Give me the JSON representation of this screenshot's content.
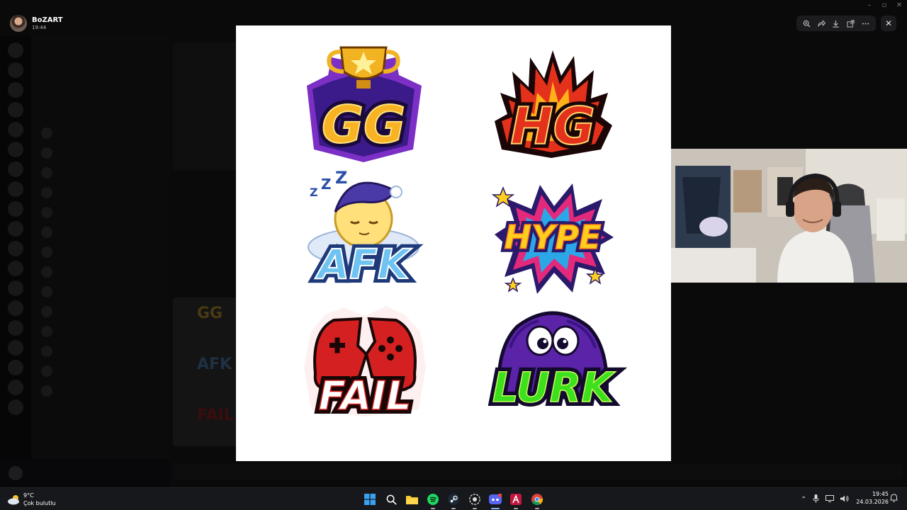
{
  "viewer": {
    "sender_name": "BoZART",
    "sender_time": "19:44",
    "toolbar_icons": [
      "zoom-in-icon",
      "forward-icon",
      "download-icon",
      "open-external-icon",
      "more-icon"
    ],
    "close_icon": "close-icon"
  },
  "stickers": [
    {
      "text": "GG",
      "colors": [
        "#f7b324",
        "#7b2fc4",
        "#1a0a3a"
      ]
    },
    {
      "text": "HG",
      "colors": [
        "#e4311b",
        "#ffb11b",
        "#1a0606"
      ]
    },
    {
      "text": "AFK",
      "colors": [
        "#6fc3f2",
        "#2c6fd6",
        "#ffe07a"
      ]
    },
    {
      "text": "HYPE",
      "colors": [
        "#ffcf1f",
        "#e3297c",
        "#2b1a6b"
      ]
    },
    {
      "text": "FAIL",
      "colors": [
        "#d42020",
        "#ffffff",
        "#1a0606"
      ]
    },
    {
      "text": "LURK",
      "colors": [
        "#3ce01c",
        "#5a23a8",
        "#130a2e"
      ]
    }
  ],
  "taskbar": {
    "weather_temp": "9°C",
    "weather_condition": "Çok bulutlu",
    "time": "19:45",
    "date": "24.03.2026",
    "apps": [
      "start",
      "search",
      "file-explorer",
      "spotify",
      "steam",
      "github",
      "discord",
      "affinity",
      "chrome"
    ]
  }
}
